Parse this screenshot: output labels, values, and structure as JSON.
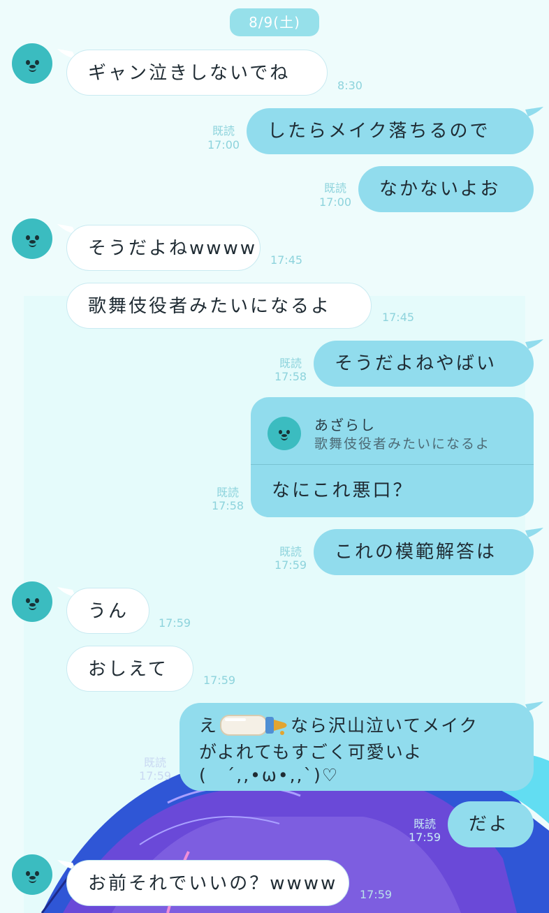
{
  "date_divider": "8/9(土)",
  "reply_card": {
    "name": "あざらし",
    "quoted": "歌舞伎役者みたいになるよ",
    "text": "なにこれ悪口？",
    "receipt": "既読",
    "time": "17:58"
  },
  "messages": [
    {
      "side": "in",
      "text": "ギャン泣きしないでね",
      "time": "8:30"
    },
    {
      "side": "out",
      "text": "したらメイク落ちるので",
      "receipt": "既読",
      "time": "17:00"
    },
    {
      "side": "out",
      "text": "なかないよお",
      "receipt": "既読",
      "time": "17:00"
    },
    {
      "side": "in",
      "text": "そうだよねwwww",
      "time": "17:45"
    },
    {
      "side": "in",
      "text": "歌舞伎役者みたいになるよ",
      "time": "17:45"
    },
    {
      "side": "out",
      "text": "そうだよねやばい",
      "receipt": "既読",
      "time": "17:58"
    },
    {
      "side": "out",
      "text": "これの模範解答は",
      "receipt": "既読",
      "time": "17:59"
    },
    {
      "side": "in",
      "text": "うん",
      "time": "17:59"
    },
    {
      "side": "in",
      "text": "おしえて",
      "time": "17:59"
    },
    {
      "side": "out",
      "text": "だよ",
      "receipt": "既読",
      "time": "17:59"
    },
    {
      "side": "in",
      "text": "お前それでいいの？wwww",
      "time": "17:59"
    }
  ],
  "multiline_message": {
    "line1_before": "え",
    "line1_after": "なら沢山泣いてメイク",
    "line2": "がよれてもすごく可愛いよ",
    "line3": "(　´,,•ω•,,`)♡",
    "receipt": "既読",
    "time": "17:59",
    "emoji": "baby-bottle-icon"
  },
  "colors": {
    "background": "#eefcfc",
    "incoming_bubble": "#ffffff",
    "outgoing_bubble": "#91dced",
    "avatar": "#3bbcc0",
    "timestamp": "#8dd3dc"
  }
}
